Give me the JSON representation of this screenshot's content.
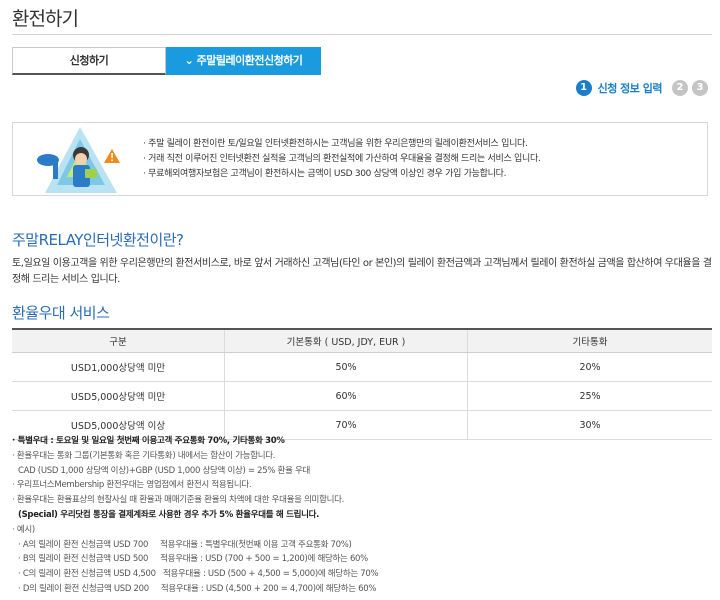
{
  "page": {
    "title": "환전하기"
  },
  "tabs": [
    {
      "label": "신청하기"
    },
    {
      "label": "주말릴레이환전신청하기",
      "chevron": "chevron-down-icon"
    }
  ],
  "steps": {
    "active_number": "1",
    "active_label": "신청 정보 입력",
    "inactive": [
      "2",
      "3"
    ]
  },
  "info": [
    "주말 릴레이 환전이란 토/일요일 인터넷환전하시는 고객님을 위한 우리은행만의 릴레이환전서비스 입니다.",
    "거래 직전 이루어진 인터넷환전 실적을 고객님의 환전실적에 가산하여 우대율을 결정해 드리는 서비스 입니다.",
    "무료해외여행자보험은 고객님이 환전하시는 금액이 USD 300 상당액 이상인 경우 가입 가능합니다."
  ],
  "relay": {
    "heading": "주말RELAY인터넷환전이란?",
    "description": "토,일요일 이용고객을 위한 우리은행만의 환전서비스로, 바로 앞서 거래하신 고객님(타인 or 본인)의 릴레이 환전금액과 고객님께서 릴레이 환전하실 금액을 합산하여 우대율을 결정해 드리는 서비스 입니다."
  },
  "rate": {
    "heading": "환율우대 서비스",
    "columns": [
      "구분",
      "기본통화 ( USD, JDY, EUR )",
      "기타통화"
    ],
    "rows": [
      [
        "USD1,000상당액 미만",
        "50%",
        "20%"
      ],
      [
        "USD5,000상당액 미만",
        "60%",
        "25%"
      ],
      [
        "USD5,000상당액 이상",
        "70%",
        "30%"
      ]
    ]
  },
  "notes": [
    "특별우대 : 토요일 및 일요일 첫번째 이용고객 주요통화 70%, 기타통화 30%",
    "환율우대는 통화 그룹(기본통화 혹은 기타통화) 내에서는 합산이 가능합니다.",
    "CAD (USD 1,000 상당액 이상)+GBP (USD 1,000 상당액 이상) = 25% 환율 우대",
    "우리프너스Membership 환전우대는 영업점에서 환전시 적용됩니다.",
    "환율우대는 환율표상의 현찰사실 때 환율과 매매기준율 환율의 차액에 대한 우대율을 의미합니다.",
    "(Special) 우리닷컴 통장을 결제계좌로 사용한 경우 추가 5% 환율우대를 해 드립니다.",
    "예시)",
    "A의 릴레이 환전 신청금액 USD 700     적용우대율 : 특별우대(첫번째 이용 고객 주요통화 70%)",
    "B의 릴레이 환전 신청금액 USD 500     적용우대율 : USD (700 + 500 = 1,200)에 해당하는 60%",
    "C의 릴레이 환전 신청금액 USD 4,500   적용우대율 : USD (500 + 4,500 = 5,000)에 해당하는 70%",
    "D의 릴레이 환전 신청금액 USD 200     적용우대율 : USD (4,500 + 200 = 4,700)에 해당하는 60%"
  ],
  "colors": {
    "accent": "#1a9be0",
    "heading": "#2a6cb5",
    "step_active": "#1a7fc8",
    "step_inactive": "#c4c4c4"
  }
}
